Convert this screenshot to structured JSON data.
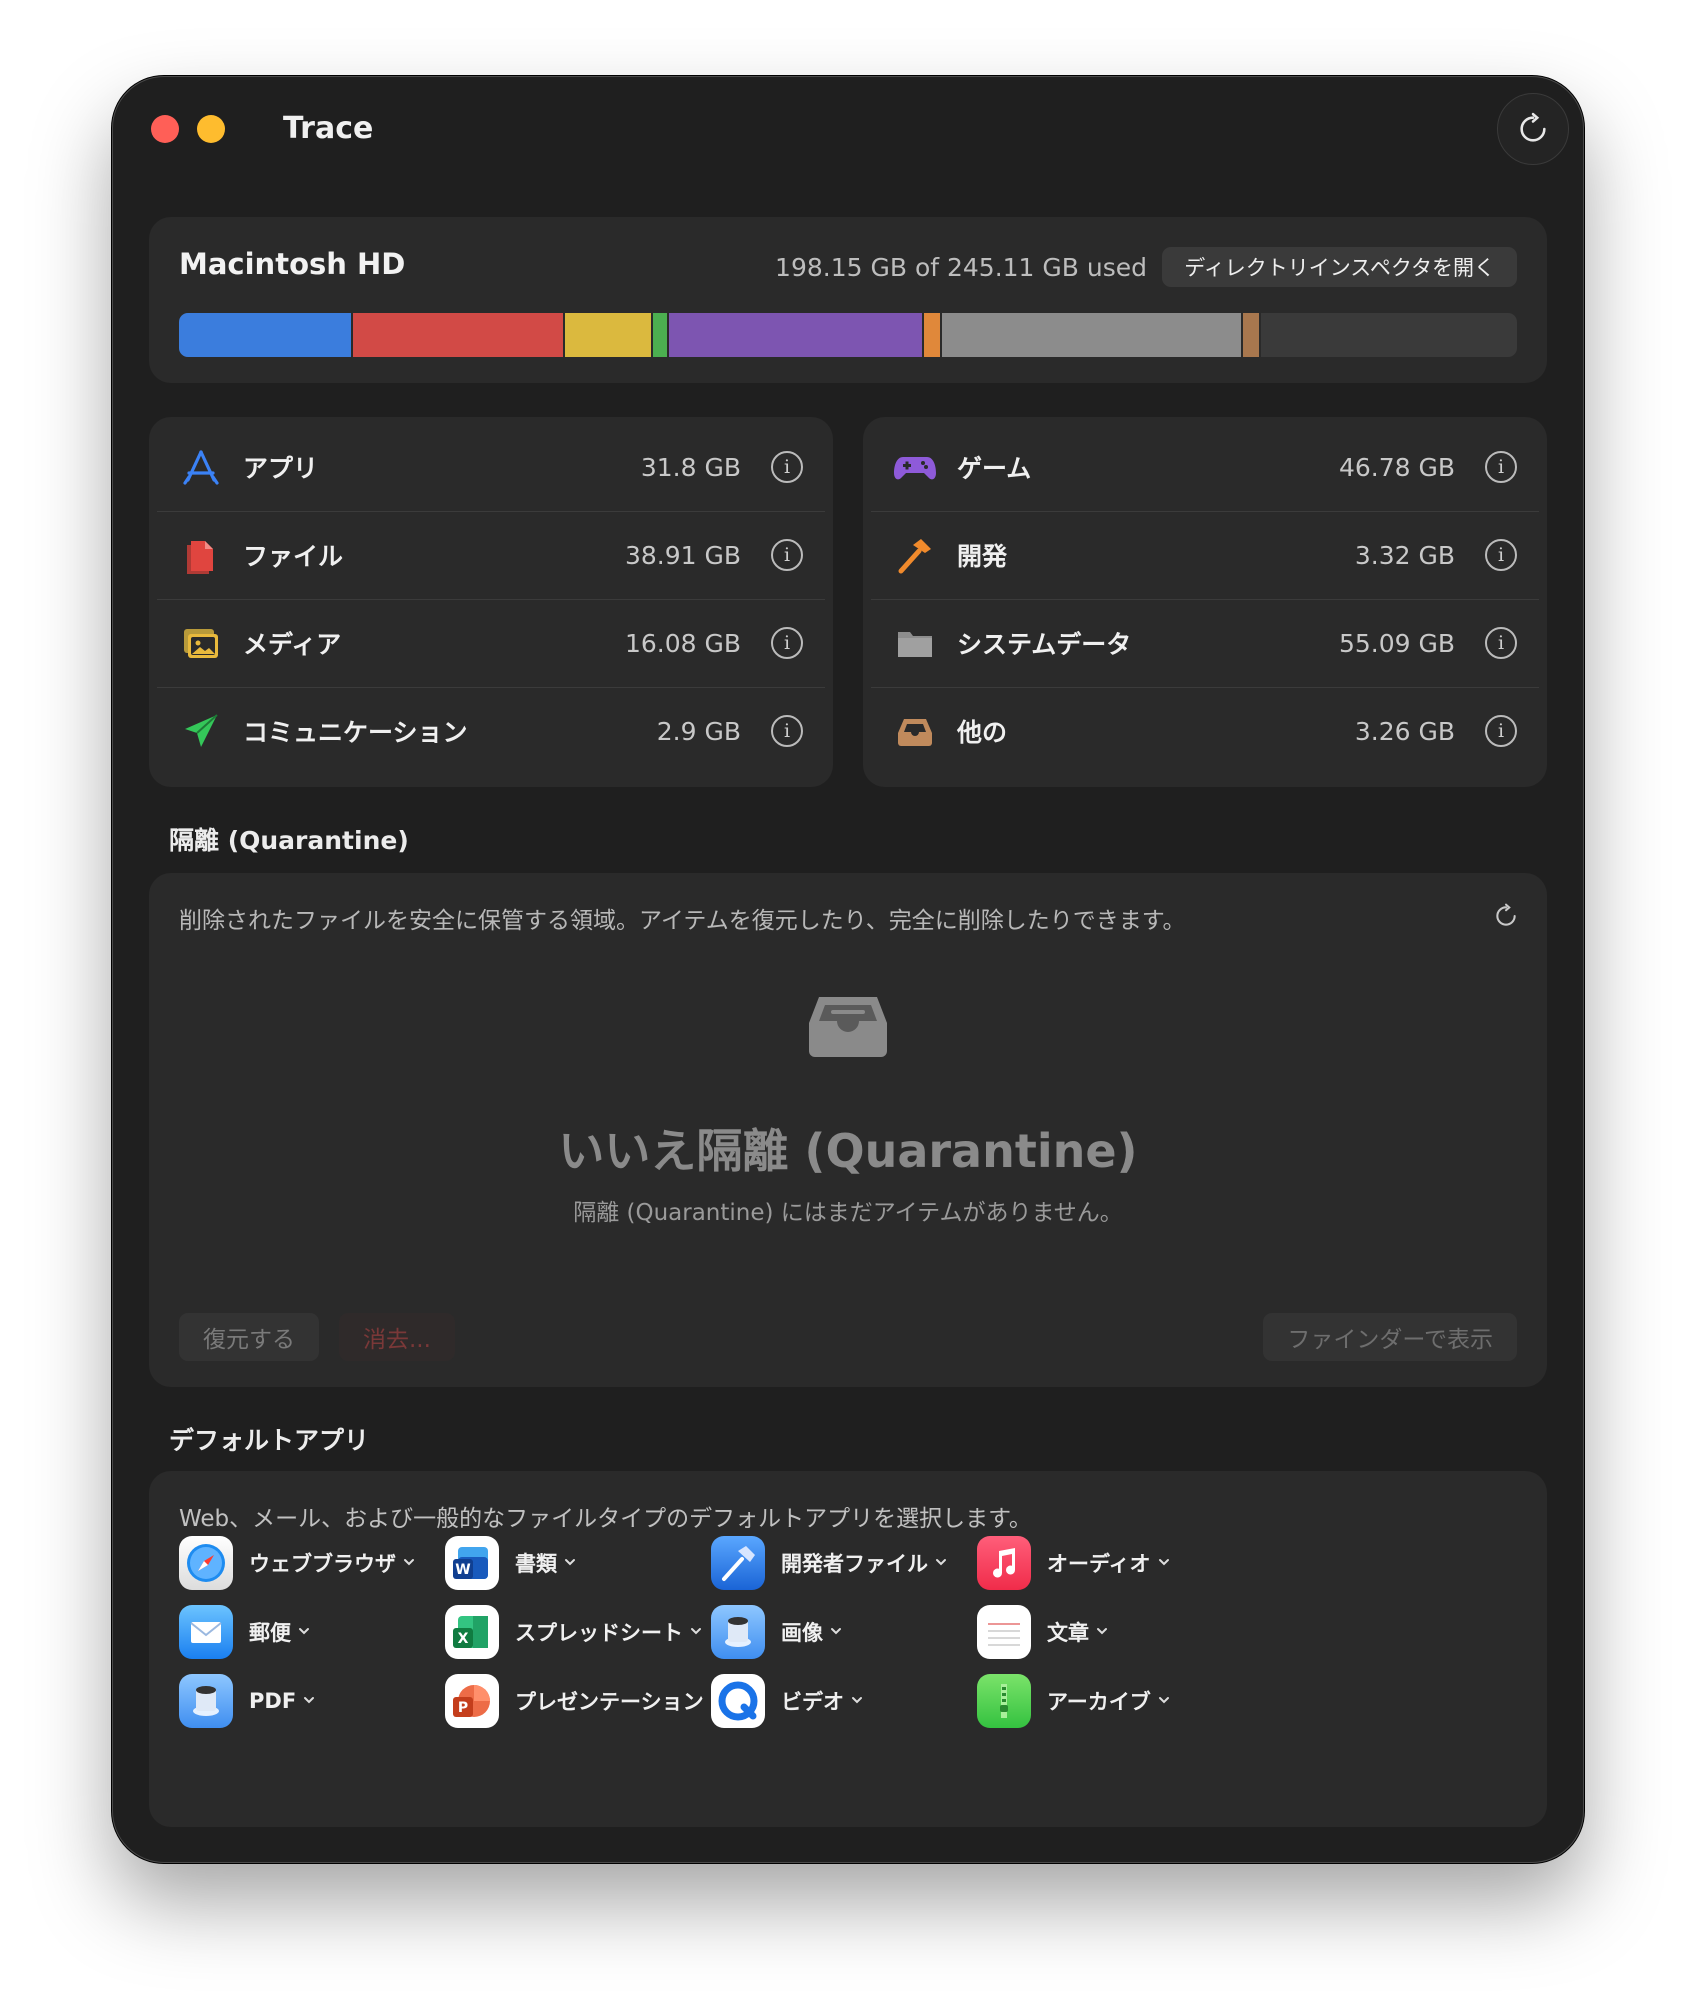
{
  "window": {
    "title": "Trace"
  },
  "disk": {
    "name": "Macintosh HD",
    "usage": "198.15 GB of 245.11 GB used",
    "open_inspector": "ディレクトリインスペクタを開く",
    "segments": [
      {
        "category": "アプリ",
        "color": "#3b7ddd",
        "gb": 31.8
      },
      {
        "category": "ファイル",
        "color": "#d24a46",
        "gb": 38.91
      },
      {
        "category": "メディア",
        "color": "#dbb93e",
        "gb": 16.08
      },
      {
        "category": "コミュニケーション",
        "color": "#4caf50",
        "gb": 2.9
      },
      {
        "category": "ゲーム",
        "color": "#7d55b1",
        "gb": 46.78
      },
      {
        "category": "開発",
        "color": "#e0883a",
        "gb": 3.32
      },
      {
        "category": "システムデータ",
        "color": "#8c8c8c",
        "gb": 55.09
      },
      {
        "category": "他の",
        "color": "#a8774e",
        "gb": 3.26
      }
    ],
    "total_gb": 245.11
  },
  "categories_left": [
    {
      "label": "アプリ",
      "size": "31.8 GB",
      "icon": "app-store-icon",
      "color": "#3b82f6"
    },
    {
      "label": "ファイル",
      "size": "38.91 GB",
      "icon": "documents-icon",
      "color": "#e0453f"
    },
    {
      "label": "メディア",
      "size": "16.08 GB",
      "icon": "photos-icon",
      "color": "#e8b93c"
    },
    {
      "label": "コミュニケーション",
      "size": "2.9 GB",
      "icon": "paper-plane-icon",
      "color": "#34c759"
    }
  ],
  "categories_right": [
    {
      "label": "ゲーム",
      "size": "46.78 GB",
      "icon": "gamecontroller-icon",
      "color": "#8e5ad9"
    },
    {
      "label": "開発",
      "size": "3.32 GB",
      "icon": "hammer-icon",
      "color": "#f08a2c"
    },
    {
      "label": "システムデータ",
      "size": "55.09 GB",
      "icon": "folder-icon",
      "color": "#a0a0a0"
    },
    {
      "label": "他の",
      "size": "3.26 GB",
      "icon": "tray-icon",
      "color": "#c08a5c"
    }
  ],
  "quarantine": {
    "heading": "隔離 (Quarantine)",
    "description": "削除されたファイルを安全に保管する領域。アイテムを復元したり、完全に削除したりできます。",
    "empty_title": "いいえ隔離 (Quarantine)",
    "empty_subtitle": "隔離 (Quarantine) にはまだアイテムがありません。",
    "restore": "復元する",
    "delete": "消去...",
    "show_in_finder": "ファインダーで表示"
  },
  "default_apps": {
    "heading": "デフォルトアプリ",
    "description": "Web、メール、および一般的なファイルタイプのデフォルトアプリを選択します。",
    "items": [
      {
        "label": "ウェブブラウザ",
        "icon": "safari-icon"
      },
      {
        "label": "書類",
        "icon": "word-icon"
      },
      {
        "label": "開発者ファイル",
        "icon": "xcode-icon"
      },
      {
        "label": "オーディオ",
        "icon": "music-icon"
      },
      {
        "label": "郵便",
        "icon": "mail-icon"
      },
      {
        "label": "スプレッドシート",
        "icon": "excel-icon"
      },
      {
        "label": "画像",
        "icon": "preview-icon"
      },
      {
        "label": "文章",
        "icon": "textedit-icon"
      },
      {
        "label": "PDF",
        "icon": "preview-pdf-icon"
      },
      {
        "label": "プレゼンテーション",
        "icon": "powerpoint-icon"
      },
      {
        "label": "ビデオ",
        "icon": "quicktime-icon"
      },
      {
        "label": "アーカイブ",
        "icon": "archive-utility-icon"
      }
    ]
  }
}
